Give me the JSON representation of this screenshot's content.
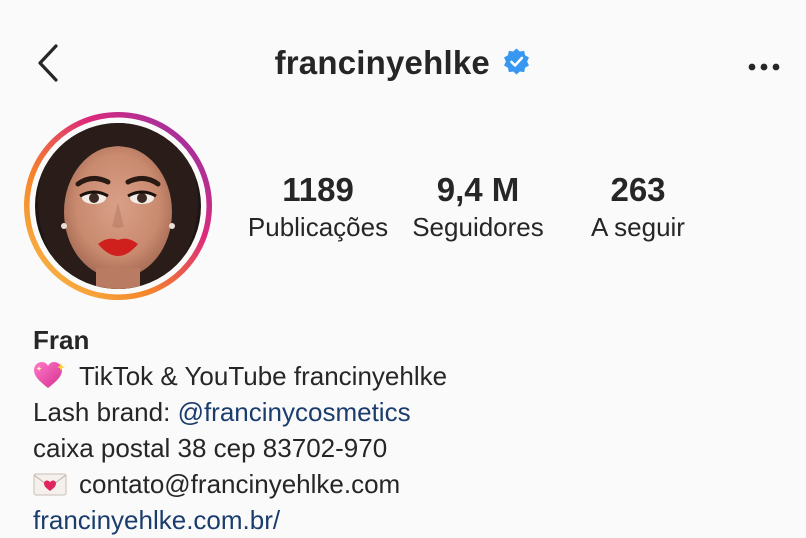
{
  "header": {
    "username": "francinyehlke",
    "verified": true,
    "back_icon": "chevron-left-icon",
    "more_icon": "more-horizontal-icon"
  },
  "stats": [
    {
      "value": "1189",
      "label": "Publicações"
    },
    {
      "value": "9,4 M",
      "label": "Seguidores"
    },
    {
      "value": "263",
      "label": "A seguir"
    }
  ],
  "bio": {
    "name": "Fran",
    "line1_text": "TikTok & YouTube francinyehlke",
    "line1_emoji": "heart-with-sparkles-emoji",
    "line2_prefix": "Lash brand: ",
    "line2_mention": "@francinycosmetics",
    "line3_text": "caixa postal 38 cep 83702-970",
    "line4_text": "contato@francinyehlke.com",
    "line4_emoji": "envelope-heart-emoji",
    "website": "francinyehlke.com.br/"
  },
  "colors": {
    "background": "#fafafa",
    "text": "#262626",
    "link": "#1b3d6d",
    "verified": "#3897f0",
    "story_ring_start": "#f58529",
    "story_ring_end": "#8134af"
  }
}
